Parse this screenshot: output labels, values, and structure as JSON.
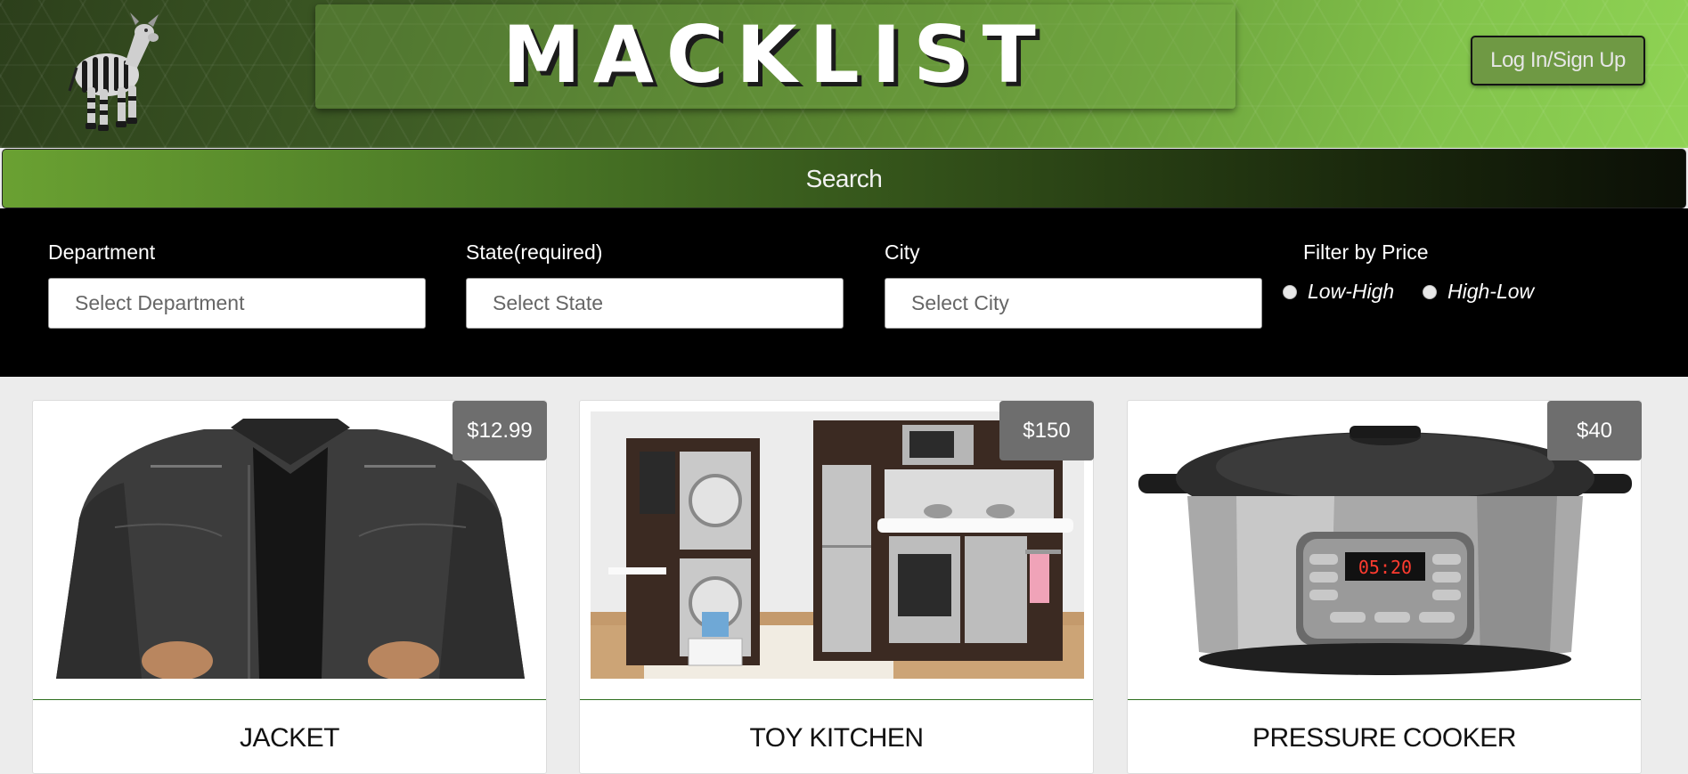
{
  "header": {
    "site_title": "MACKLIST",
    "login_label": "Log In/Sign Up",
    "logo_icon": "okapi-logo-icon"
  },
  "search": {
    "button_label": "Search"
  },
  "filters": {
    "department": {
      "label": "Department",
      "placeholder": "Select Department"
    },
    "state": {
      "label": "State(required)",
      "placeholder": "Select State"
    },
    "city": {
      "label": "City",
      "placeholder": "Select City"
    },
    "price": {
      "label": "Filter by Price",
      "options": [
        "Low-High",
        "High-Low"
      ]
    }
  },
  "products": [
    {
      "title": "JACKET",
      "price": "$12.99",
      "image_icon": "leather-jacket-photo"
    },
    {
      "title": "TOY KITCHEN",
      "price": "$150",
      "image_icon": "toy-kitchen-photo"
    },
    {
      "title": "PRESSURE COOKER",
      "price": "$40",
      "image_icon": "pressure-cooker-photo",
      "display": "05:20"
    }
  ],
  "colors": {
    "brand_green": "#6aa132",
    "header_dark": "#2c3f1b",
    "filter_bg": "#000000",
    "price_badge": "#6e6e6e"
  }
}
